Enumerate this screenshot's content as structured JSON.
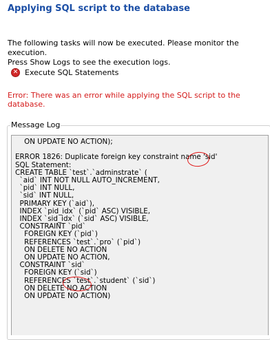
{
  "header": {
    "title": "Applying SQL script to the database"
  },
  "description": {
    "line1": "The following tasks will now be executed. Please monitor the execution.",
    "line2": "Press Show Logs to see the execution logs."
  },
  "task": {
    "icon": "error-x-icon",
    "label": "Execute SQL Statements"
  },
  "error_message": "Error: There was an error while applying the SQL script to the database.",
  "message_log": {
    "label": "Message Log",
    "lines": [
      "    ON UPDATE NO ACTION);",
      "",
      "ERROR 1826: Duplicate foreign key constraint name 'sid'",
      "SQL Statement:",
      "CREATE TABLE `test`.`adminstrate` (",
      "  `aid` INT NOT NULL AUTO_INCREMENT,",
      "  `pid` INT NULL,",
      "  `sid` INT NULL,",
      "  PRIMARY KEY (`aid`),",
      "  INDEX `pid_idx` (`pid` ASC) VISIBLE,",
      "  INDEX `sid_idx` (`sid` ASC) VISIBLE,",
      "  CONSTRAINT `pid`",
      "    FOREIGN KEY (`pid`)",
      "    REFERENCES `test`.`pro` (`pid`)",
      "    ON DELETE NO ACTION",
      "    ON UPDATE NO ACTION,",
      "  CONSTRAINT `sid`",
      "    FOREIGN KEY (`sid`)",
      "    REFERENCES `test`.`student` (`sid`)",
      "    ON DELETE NO ACTION",
      "    ON UPDATE NO ACTION)"
    ]
  },
  "colors": {
    "title": "#1c4fa6",
    "error": "#d41a1a",
    "annotation": "#e01414",
    "log_background": "#f0f0f0"
  }
}
